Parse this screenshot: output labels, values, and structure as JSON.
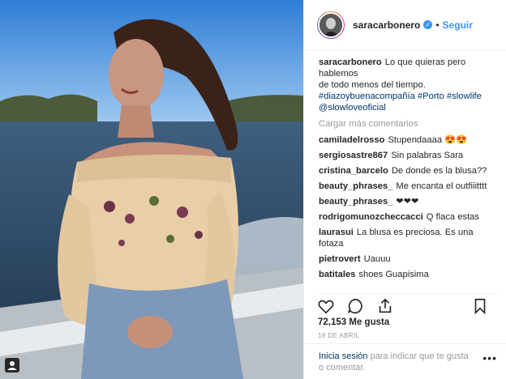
{
  "post": {
    "username": "saracarbonero",
    "follow_label": "Seguir",
    "separator": "•",
    "caption": {
      "author": "saracarbonero",
      "line1": "Lo que quieras pero hablemos",
      "line2": "de todo menos del tiempo.",
      "hashtags": "#diazoybuenacompañía #Porto #slowlife @slowloveoficial"
    },
    "load_more": "Cargar más comentarios",
    "comments": [
      {
        "user": "camiladelrosso",
        "text": "Stupendaaaa 😍😍"
      },
      {
        "user": "sergiosastre867",
        "text": "Sin palabras Sara"
      },
      {
        "user": "cristina_barcelo",
        "text": "De donde es la blusa??"
      },
      {
        "user": "beauty_phrases_",
        "text": "Me encanta el outfiiitttt"
      },
      {
        "user": "beauty_phrases_",
        "text": "❤❤❤"
      },
      {
        "user": "rodrigomunozcheccacci",
        "text": "Q flaca estas"
      },
      {
        "user": "laurasui",
        "text": "La blusa es preciosa. Es una fotaza"
      },
      {
        "user": "pietrovert",
        "text": "Uauuu"
      },
      {
        "user": "batitales",
        "text": "shoes Guapisima"
      }
    ],
    "likes": "72,153 Me gusta",
    "date": "18 DE ABRIL",
    "login_link": "Inicia sesión",
    "login_text": "para indicar que te gusta o comentar.",
    "more_label": "•••"
  },
  "icons": [
    "heart-icon",
    "comment-icon",
    "share-icon",
    "bookmark-icon",
    "verified-icon",
    "user-tag-icon"
  ]
}
